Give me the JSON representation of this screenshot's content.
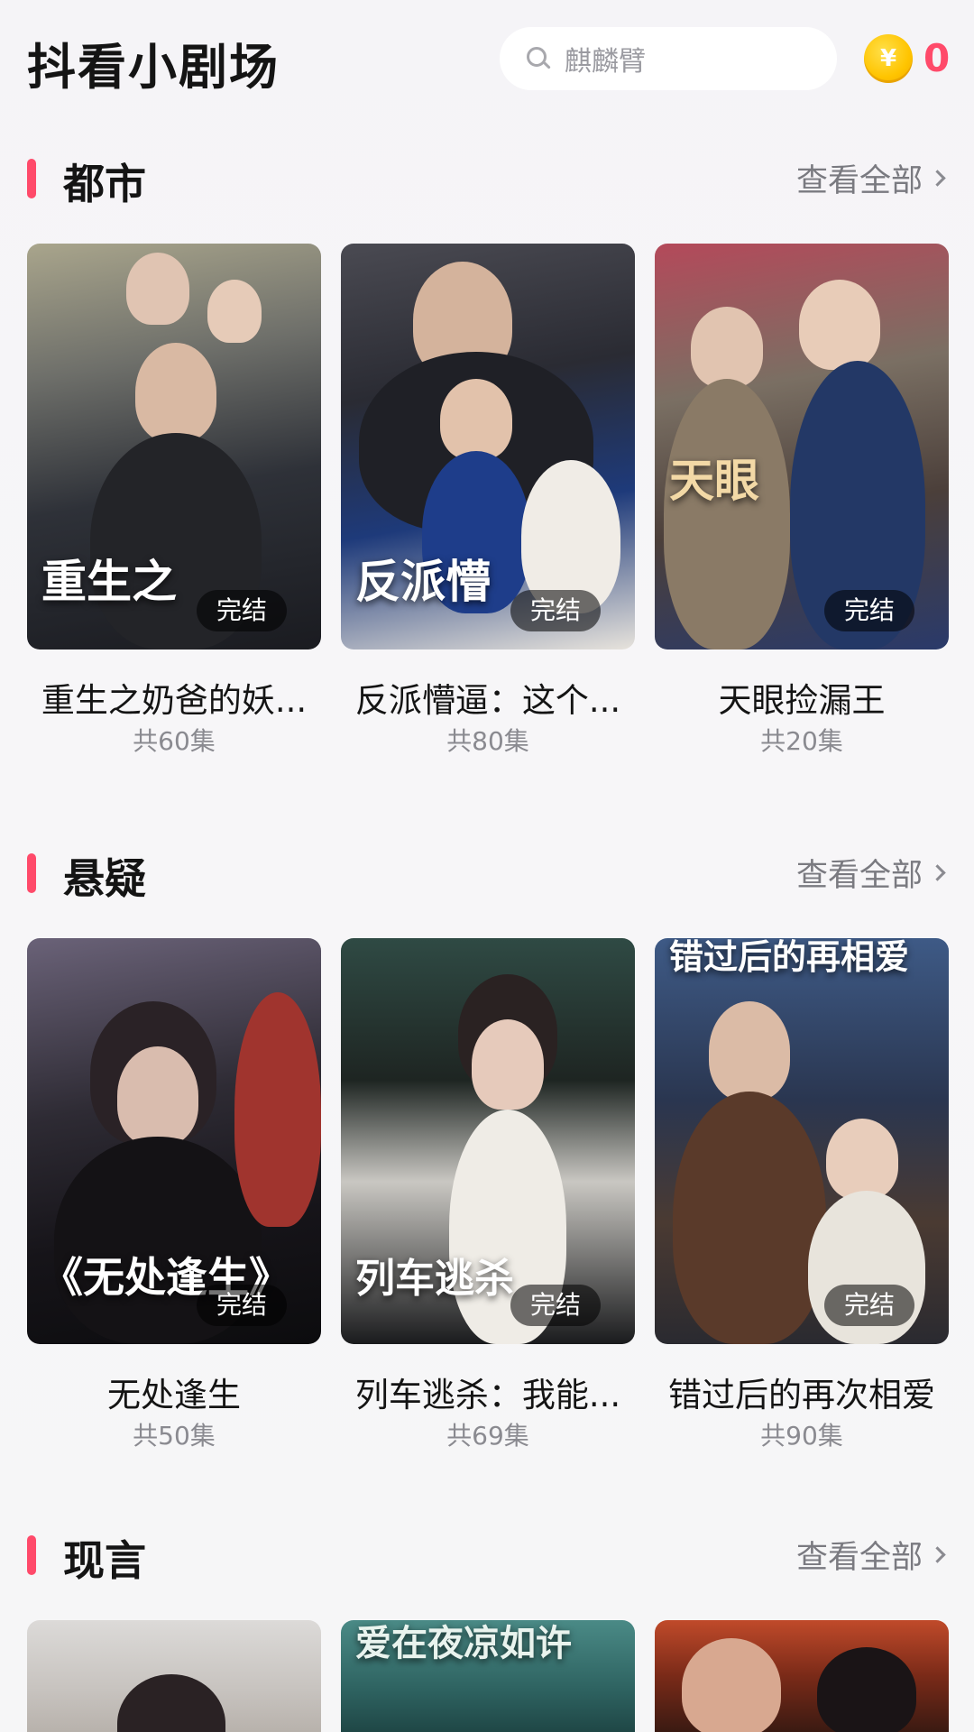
{
  "header": {
    "app_title": "抖看小剧场",
    "search_placeholder": "麒麟臂",
    "coin_symbol": "¥",
    "coin_count": "0"
  },
  "colors": {
    "accent": "#ff4a6a",
    "coin": "#ffc400"
  },
  "sections": [
    {
      "title": "都市",
      "see_all": "查看全部",
      "items": [
        {
          "title": "重生之奶爸的妖...",
          "episodes": "共60集",
          "badge": "完结",
          "poster_text": "重生之"
        },
        {
          "title": "反派懵逼：这个...",
          "episodes": "共80集",
          "badge": "完结",
          "poster_text": "反派懵"
        },
        {
          "title": "天眼捡漏王",
          "episodes": "共20集",
          "badge": "完结",
          "poster_text": "天眼"
        }
      ]
    },
    {
      "title": "悬疑",
      "see_all": "查看全部",
      "items": [
        {
          "title": "无处逢生",
          "episodes": "共50集",
          "badge": "完结",
          "poster_text": "《无处逢生》"
        },
        {
          "title": "列车逃杀：我能...",
          "episodes": "共69集",
          "badge": "完结",
          "poster_text": "列车逃杀"
        },
        {
          "title": "错过后的再次相爱",
          "episodes": "共90集",
          "badge": "完结",
          "poster_text": "错过后的再相爱"
        }
      ]
    },
    {
      "title": "现言",
      "see_all": "查看全部",
      "items": [
        {
          "poster_text": ""
        },
        {
          "poster_text": "爱在夜凉如许"
        },
        {
          "poster_text": ""
        }
      ]
    }
  ]
}
